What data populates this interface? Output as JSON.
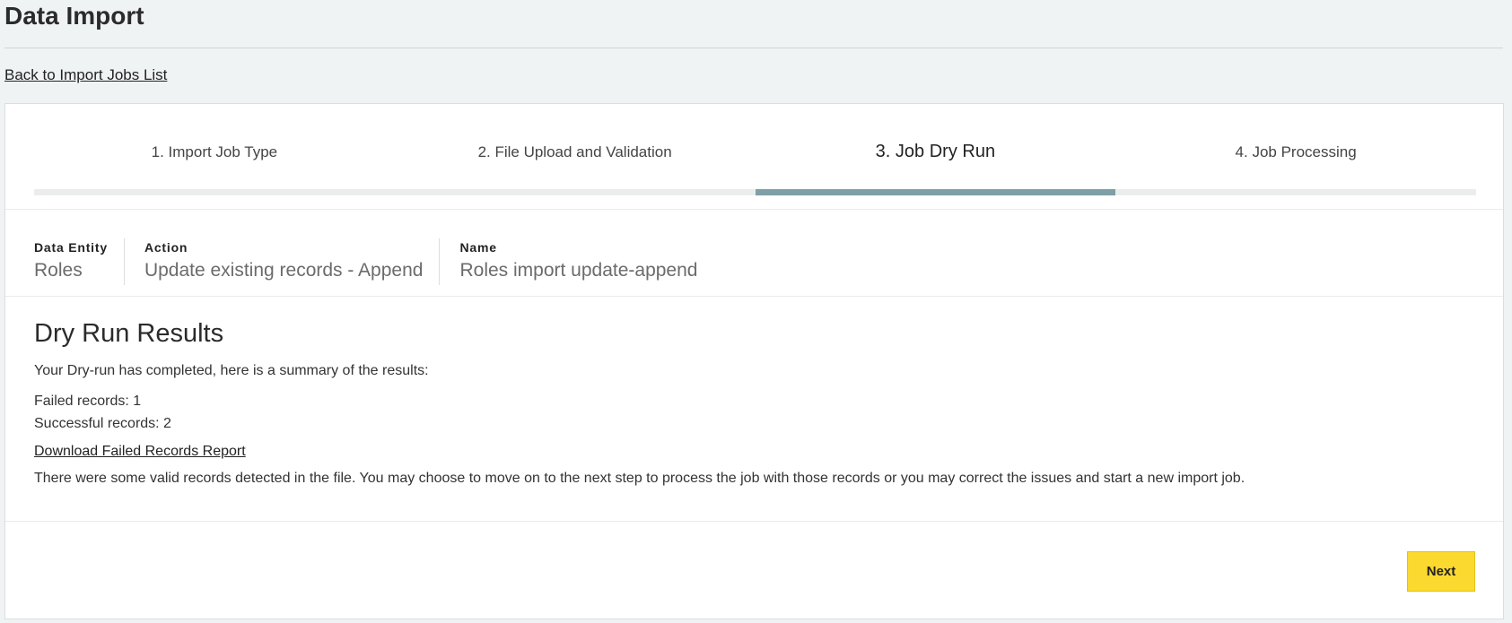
{
  "header": {
    "title": "Data Import",
    "back_link": "Back to Import Jobs List"
  },
  "steps": [
    {
      "label": "1. Import Job Type",
      "active": false
    },
    {
      "label": "2. File Upload and Validation",
      "active": false
    },
    {
      "label": "3. Job Dry Run",
      "active": true
    },
    {
      "label": "4. Job Processing",
      "active": false
    }
  ],
  "meta": {
    "data_entity_label": "Data Entity",
    "data_entity_value": "Roles",
    "action_label": "Action",
    "action_value": "Update existing records - Append",
    "name_label": "Name",
    "name_value": "Roles import update-append"
  },
  "results": {
    "heading": "Dry Run Results",
    "summary": "Your Dry-run has completed, here is a summary of the results:",
    "failed": "Failed records: 1",
    "successful": "Successful records: 2",
    "download_link": "Download Failed Records Report",
    "note": "There were some valid records detected in the file. You may choose to move on to the next step to process the job with those records or you may correct the issues and start a new import job."
  },
  "footer": {
    "next_label": "Next"
  },
  "colors": {
    "active_step_bar": "#7e9fa6",
    "next_button": "#fcd92e"
  }
}
